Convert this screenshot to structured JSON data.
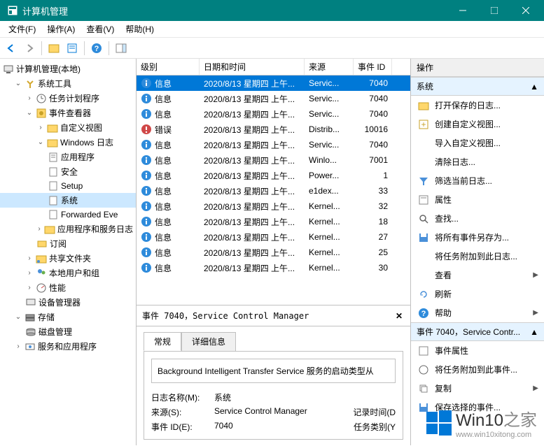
{
  "window": {
    "title": "计算机管理"
  },
  "menu": {
    "file": "文件(F)",
    "action": "操作(A)",
    "view": "查看(V)",
    "help": "帮助(H)"
  },
  "tree": {
    "root": "计算机管理(本地)",
    "system_tools": "系统工具",
    "task_scheduler": "任务计划程序",
    "event_viewer": "事件查看器",
    "custom_views": "自定义视图",
    "windows_logs": "Windows 日志",
    "application": "应用程序",
    "security": "安全",
    "setup": "Setup",
    "system": "系统",
    "forwarded": "Forwarded Eve",
    "app_service_logs": "应用程序和服务日志",
    "subscriptions": "订阅",
    "shared_folders": "共享文件夹",
    "local_users": "本地用户和组",
    "performance": "性能",
    "device_manager": "设备管理器",
    "storage": "存储",
    "disk_management": "磁盘管理",
    "services_apps": "服务和应用程序"
  },
  "grid": {
    "cols": {
      "level": "级别",
      "datetime": "日期和时间",
      "source": "来源",
      "eventid": "事件 ID"
    },
    "rows": [
      {
        "level": "信息",
        "icon": "info",
        "dt": "2020/8/13 星期四 上午...",
        "src": "Servic...",
        "id": "7040",
        "sel": true
      },
      {
        "level": "信息",
        "icon": "info",
        "dt": "2020/8/13 星期四 上午...",
        "src": "Servic...",
        "id": "7040"
      },
      {
        "level": "信息",
        "icon": "info",
        "dt": "2020/8/13 星期四 上午...",
        "src": "Servic...",
        "id": "7040"
      },
      {
        "level": "错误",
        "icon": "error",
        "dt": "2020/8/13 星期四 上午...",
        "src": "Distrib...",
        "id": "10016"
      },
      {
        "level": "信息",
        "icon": "info",
        "dt": "2020/8/13 星期四 上午...",
        "src": "Servic...",
        "id": "7040"
      },
      {
        "level": "信息",
        "icon": "info",
        "dt": "2020/8/13 星期四 上午...",
        "src": "Winlo...",
        "id": "7001"
      },
      {
        "level": "信息",
        "icon": "info",
        "dt": "2020/8/13 星期四 上午...",
        "src": "Power...",
        "id": "1"
      },
      {
        "level": "信息",
        "icon": "info",
        "dt": "2020/8/13 星期四 上午...",
        "src": "e1dex...",
        "id": "33"
      },
      {
        "level": "信息",
        "icon": "info",
        "dt": "2020/8/13 星期四 上午...",
        "src": "Kernel...",
        "id": "32"
      },
      {
        "level": "信息",
        "icon": "info",
        "dt": "2020/8/13 星期四 上午...",
        "src": "Kernel...",
        "id": "18"
      },
      {
        "level": "信息",
        "icon": "info",
        "dt": "2020/8/13 星期四 上午...",
        "src": "Kernel...",
        "id": "27"
      },
      {
        "level": "信息",
        "icon": "info",
        "dt": "2020/8/13 星期四 上午...",
        "src": "Kernel...",
        "id": "25"
      },
      {
        "level": "信息",
        "icon": "info",
        "dt": "2020/8/13 星期四 上午...",
        "src": "Kernel...",
        "id": "30"
      }
    ]
  },
  "detail": {
    "title": "事件 7040，Service Control Manager",
    "tab_general": "常规",
    "tab_details": "详细信息",
    "message": "Background Intelligent Transfer Service 服务的启动类型从",
    "log_name_lbl": "日志名称(M):",
    "log_name_val": "系统",
    "source_lbl": "来源(S):",
    "source_val": "Service Control Manager",
    "logged_lbl": "记录时间(D",
    "eventid_lbl": "事件 ID(E):",
    "eventid_val": "7040",
    "taskcat_lbl": "任务类别(Y"
  },
  "actions": {
    "header": "操作",
    "group1": "系统",
    "open_saved": "打开保存的日志...",
    "create_custom": "创建自定义视图...",
    "import_custom": "导入自定义视图...",
    "clear_log": "清除日志...",
    "filter_log": "筛选当前日志...",
    "properties": "属性",
    "find": "查找...",
    "save_all": "将所有事件另存为...",
    "attach_task": "将任务附加到此日志...",
    "view": "查看",
    "refresh": "刷新",
    "help": "帮助",
    "group2": "事件 7040，Service Contr...",
    "event_props": "事件属性",
    "attach_task_event": "将任务附加到此事件...",
    "copy": "复制",
    "save_selected": "保存选择的事件..."
  },
  "watermark": {
    "brand": "Win10",
    "suffix": "之家",
    "url": "www.win10xitong.com"
  }
}
